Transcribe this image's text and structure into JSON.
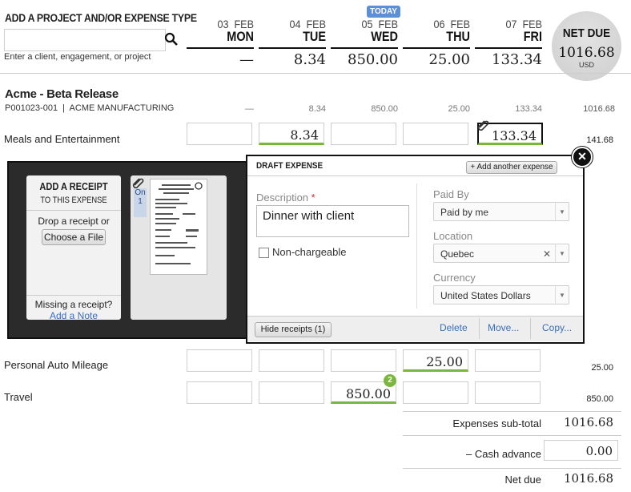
{
  "header": {
    "title": "ADD A PROJECT AND/OR EXPENSE TYPE",
    "search_placeholder": "",
    "hint": "Enter a client, engagement, or project",
    "today_badge": "TODAY",
    "net_due_label": "NET DUE",
    "net_due_value": "1016.68",
    "net_due_currency": "USD"
  },
  "days": [
    {
      "date": "03  FEB",
      "name": "MON",
      "total": "—"
    },
    {
      "date": "04  FEB",
      "name": "TUE",
      "total": "8.34"
    },
    {
      "date": "05  FEB",
      "name": "WED",
      "total": "850.00"
    },
    {
      "date": "06  FEB",
      "name": "THU",
      "total": "25.00"
    },
    {
      "date": "07  FEB",
      "name": "FRI",
      "total": "133.34"
    }
  ],
  "project": {
    "name": "Acme - Beta Release",
    "code": "P001023-001  |  ACME MANUFACTURING",
    "day_totals": [
      "—",
      "8.34",
      "850.00",
      "25.00",
      "133.34"
    ],
    "total": "1016.68"
  },
  "rows": [
    {
      "label": "Meals and Entertainment",
      "values": [
        "",
        "8.34",
        "",
        "",
        "133.34"
      ],
      "total": "141.68"
    },
    {
      "label": "Personal Auto Mileage",
      "values": [
        "",
        "",
        "",
        "25.00",
        ""
      ],
      "total": "25.00"
    },
    {
      "label": "Travel",
      "values": [
        "",
        "",
        "850.00",
        "",
        ""
      ],
      "total": "850.00",
      "badge": "2"
    }
  ],
  "receipt_panel": {
    "title": "ADD A RECEIPT",
    "subtitle": "TO THIS EXPENSE",
    "drop_text": "Drop a receipt or",
    "choose_button": "Choose a File",
    "missing_text": "Missing a receipt?",
    "add_note_link": "Add a Note",
    "thumb_tab_line1": "On",
    "thumb_tab_line2": "1"
  },
  "draft": {
    "title": "DRAFT EXPENSE",
    "add_another": "+ Add another expense",
    "description_label": "Description",
    "required_mark": "*",
    "description_value": "Dinner with client",
    "non_chargeable_label": "Non-chargeable",
    "paid_by_label": "Paid By",
    "paid_by_value": "Paid by me",
    "location_label": "Location",
    "location_value": "Quebec",
    "currency_label": "Currency",
    "currency_value": "United States Dollars",
    "hide_receipts": "Hide receipts (1)",
    "delete": "Delete",
    "move": "Move...",
    "copy": "Copy..."
  },
  "footer": {
    "subtotal_label": "Expenses sub-total",
    "subtotal_value": "1016.68",
    "cash_advance_label": "– Cash advance",
    "cash_advance_value": "0.00",
    "net_due_label": "Net due",
    "net_due_value": "1016.68"
  },
  "colors": {
    "accent_green": "#7bb73c",
    "today_blue": "#5b8fd8",
    "dark_panel": "#2b2b2b"
  }
}
